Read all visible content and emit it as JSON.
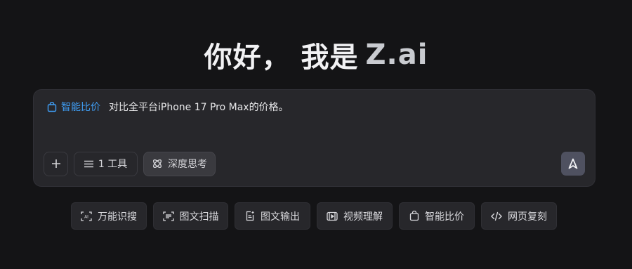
{
  "headline": {
    "greeting": "你好， 我是",
    "brand": "Z.ai"
  },
  "composer": {
    "mode_tag": "智能比价",
    "mode_icon": "shopping-bag-icon",
    "prompt_text": "对比全平台iPhone 17 Pro Max的价格。",
    "tools_label": "1 工具",
    "think_label": "深度思考",
    "accent_color": "#3f9ef5"
  },
  "shortcuts": [
    {
      "label": "万能识搜",
      "icon": "ai-scan-icon"
    },
    {
      "label": "图文扫描",
      "icon": "scan-frame-icon"
    },
    {
      "label": "图文输出",
      "icon": "doc-sparkle-icon"
    },
    {
      "label": "视频理解",
      "icon": "film-icon"
    },
    {
      "label": "智能比价",
      "icon": "shopping-bag-icon"
    },
    {
      "label": "网页复刻",
      "icon": "code-icon"
    }
  ]
}
